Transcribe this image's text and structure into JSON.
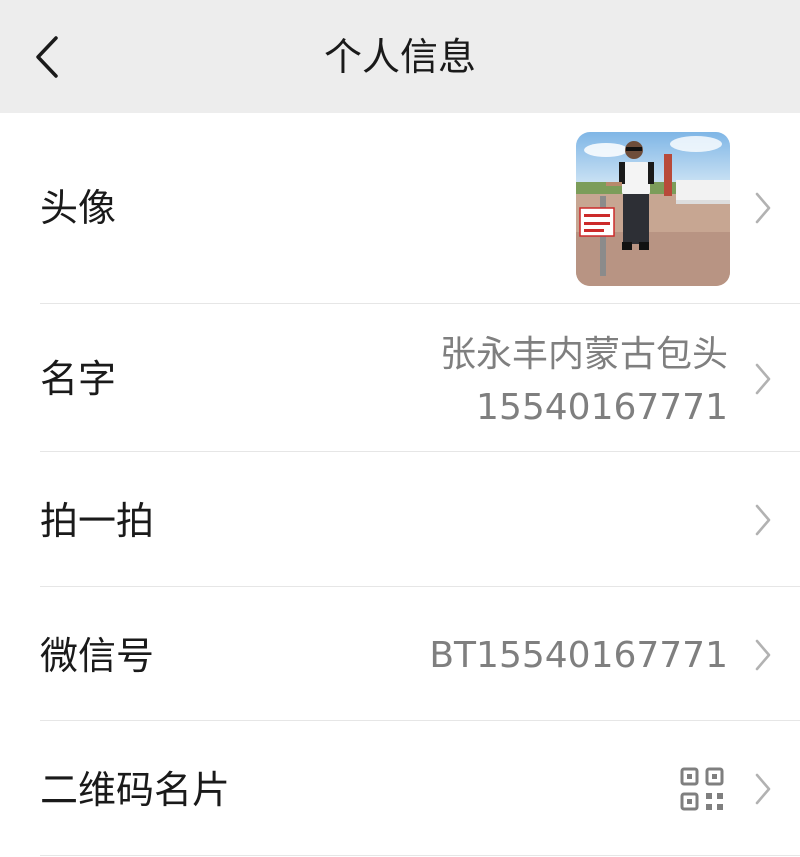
{
  "header": {
    "title": "个人信息",
    "back_icon": "chevron-left-icon"
  },
  "rows": {
    "avatar": {
      "label": "头像",
      "icon": "avatar-photo"
    },
    "name": {
      "label": "名字",
      "value_line1": "张永丰内蒙古包头",
      "value_line2": "15540167771"
    },
    "pat": {
      "label": "拍一拍"
    },
    "wechat_id": {
      "label": "微信号",
      "value": "BT15540167771"
    },
    "qrcode": {
      "label": "二维码名片",
      "icon": "qr-code-icon"
    }
  },
  "colors": {
    "header_bg": "#ededed",
    "label": "#1a1a1a",
    "value": "#7f7f7f",
    "chevron": "#b2b2b2",
    "divider": "#e6e6e6"
  }
}
